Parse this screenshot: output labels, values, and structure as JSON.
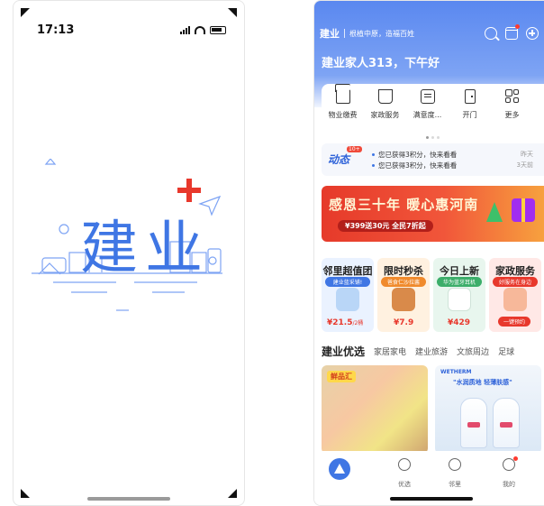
{
  "splash": {
    "time": "17:13",
    "title": "建业"
  },
  "app": {
    "logo": "建业",
    "slogan": "根植中原，造福百姓",
    "greeting": "建业家人313，下午好",
    "services": [
      {
        "label": "物业缴费",
        "icon": "house-heart-icon"
      },
      {
        "label": "家政服务",
        "icon": "broom-icon"
      },
      {
        "label": "满意度...",
        "icon": "survey-icon"
      },
      {
        "label": "开门",
        "icon": "door-icon"
      },
      {
        "label": "更多",
        "icon": "grid-more-icon"
      }
    ],
    "news": {
      "logo": "动态",
      "badge": "10+",
      "items": [
        {
          "text": "您已获得3积分，快来看看",
          "time": "昨天"
        },
        {
          "text": "您已获得3积分，快来看看",
          "time": "3天前"
        }
      ]
    },
    "banner": {
      "title": "感恩三十年 暖心惠河南",
      "subtitle": "¥399送30元 全民7折起"
    },
    "promos": [
      {
        "title": "邻里超值团",
        "sub": "建业蓝采铺!",
        "price": "¥21.5",
        "unit": "/2桶",
        "color": "#eaf2ff",
        "subColor": "#3f76e4"
      },
      {
        "title": "限时秒杀",
        "sub": "爸食仁沙拉酱",
        "price": "¥7.9",
        "unit": "",
        "color": "#fff1e0",
        "subColor": "#f08a2c"
      },
      {
        "title": "今日上新",
        "sub": "华为蓝牙耳机",
        "price": "¥429",
        "unit": "",
        "color": "#e8f6ee",
        "subColor": "#3cae6a"
      },
      {
        "title": "家政服务",
        "sub": "好服务在身边",
        "tag": "一键预约",
        "color": "#ffe8e6",
        "subColor": "#e8382c"
      }
    ],
    "tabs": [
      "建业优选",
      "家居家电",
      "建业旅游",
      "文旅周边",
      "足球"
    ],
    "products": [
      {
        "label": "鲜品汇"
      },
      {
        "brand": "WETHERM",
        "tag": "\"水润质地 轻薄肤感\""
      }
    ],
    "nav": [
      {
        "label": ""
      },
      {
        "label": "优选"
      },
      {
        "label": "邻里"
      },
      {
        "label": "我的"
      }
    ]
  }
}
